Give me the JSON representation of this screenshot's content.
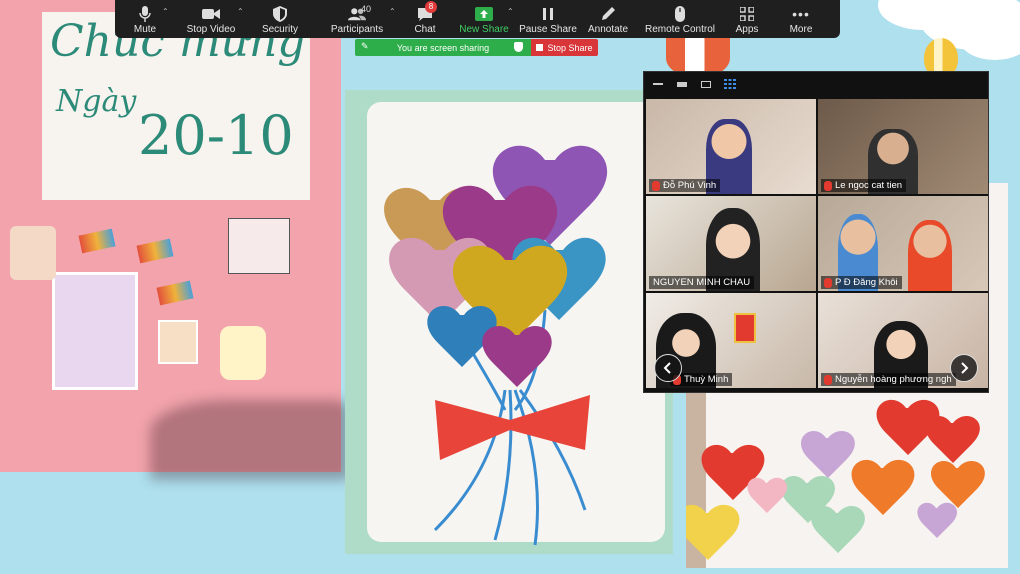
{
  "toolbar": {
    "items": [
      {
        "label": "Mute"
      },
      {
        "label": "Stop Video"
      },
      {
        "label": "Security"
      },
      {
        "label": "Participants",
        "count": "40"
      },
      {
        "label": "Chat",
        "badge": "8"
      },
      {
        "label": "New Share"
      },
      {
        "label": "Pause Share"
      },
      {
        "label": "Annotate"
      },
      {
        "label": "Remote Control"
      },
      {
        "label": "Apps"
      },
      {
        "label": "More"
      }
    ],
    "accent": "#2eae4a"
  },
  "share_bar": {
    "status": "You are screen sharing",
    "stop_label": "Stop Share",
    "green": "#2eae4a",
    "red": "#d9363a"
  },
  "gallery": {
    "participants": [
      {
        "name": "Đỗ Phú Vinh"
      },
      {
        "name": "Le ngoc cat tien"
      },
      {
        "name": "NGUYEN MINH CHAU"
      },
      {
        "name": "P Đ Đăng Khôi"
      },
      {
        "name": "Thuỳ Minh"
      },
      {
        "name": "Nguyễn hoàng phương ngh"
      }
    ]
  },
  "card_left": {
    "line1": "Chúc mừng",
    "line2": "Ngày",
    "line3": "20-10"
  }
}
